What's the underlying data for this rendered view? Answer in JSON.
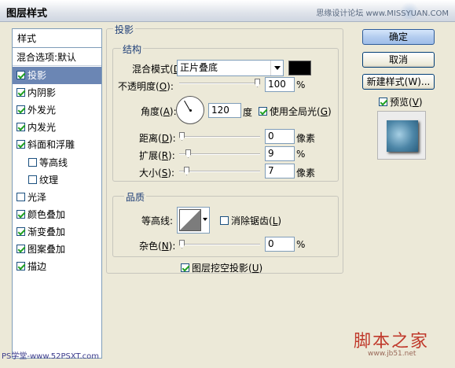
{
  "window": {
    "title": "图层样式",
    "watermark_top": "思缘设计论坛  www.MISSYUAN.COM"
  },
  "left_panel": {
    "header": "样式",
    "blend_options": "混合选项:默认",
    "items": [
      {
        "label": "投影",
        "checked": true,
        "selected": true
      },
      {
        "label": "内阴影",
        "checked": true
      },
      {
        "label": "外发光",
        "checked": true
      },
      {
        "label": "内发光",
        "checked": true
      },
      {
        "label": "斜面和浮雕",
        "checked": true
      },
      {
        "label": "等高线",
        "checked": false,
        "indent": true
      },
      {
        "label": "纹理",
        "checked": false,
        "indent": true
      },
      {
        "label": "光泽",
        "checked": false
      },
      {
        "label": "颜色叠加",
        "checked": true
      },
      {
        "label": "渐变叠加",
        "checked": true
      },
      {
        "label": "图案叠加",
        "checked": true
      },
      {
        "label": "描边",
        "checked": true
      }
    ]
  },
  "drop_shadow": {
    "section_title": "投影",
    "structure": {
      "title": "结构",
      "blend_mode_label": "混合模式(",
      "blend_mode_key": "D",
      "blend_mode_tail": "):",
      "blend_mode_value": "正片叠底",
      "blend_color": "#000000",
      "opacity_label": "不透明度(",
      "opacity_key": "O",
      "opacity_tail": "):",
      "opacity_value": "100",
      "opacity_fraction": 1.0,
      "opacity_unit": "%",
      "angle_label": "角度(",
      "angle_key": "A",
      "angle_tail": "):",
      "angle_value": "120",
      "angle_unit": "度",
      "global_light_label": "使用全局光(",
      "global_light_key": "G",
      "global_light_tail": ")",
      "global_light_checked": true,
      "distance_label": "距离(",
      "distance_key": "D",
      "distance_tail": "):",
      "distance_value": "0",
      "distance_unit": "像素",
      "spread_label": "扩展(",
      "spread_key": "R",
      "spread_tail": "):",
      "spread_value": "9",
      "spread_unit": "%",
      "size_label": "大小(",
      "size_key": "S",
      "size_tail": "):",
      "size_value": "7",
      "size_unit": "像素"
    },
    "quality": {
      "title": "品质",
      "contour_label": "等高线:",
      "antialias_label": "消除锯齿(",
      "antialias_key": "L",
      "antialias_tail": ")",
      "antialias_checked": false,
      "noise_label": "杂色(",
      "noise_key": "N",
      "noise_tail": "):",
      "noise_value": "0",
      "noise_unit": "%"
    },
    "knockout_label": "图层挖空投影(",
    "knockout_key": "U",
    "knockout_tail": ")",
    "knockout_checked": true
  },
  "buttons": {
    "ok": "确定",
    "cancel": "取消",
    "new_style": "新建样式(W)...",
    "preview_label": "预览(",
    "preview_key": "V",
    "preview_tail": ")",
    "preview_checked": true
  },
  "watermarks": {
    "bottom_left": "PS学堂-www.52PSXT.com",
    "bottom_right": "脚本之家",
    "bottom_right_url": "www.jb51.net"
  }
}
